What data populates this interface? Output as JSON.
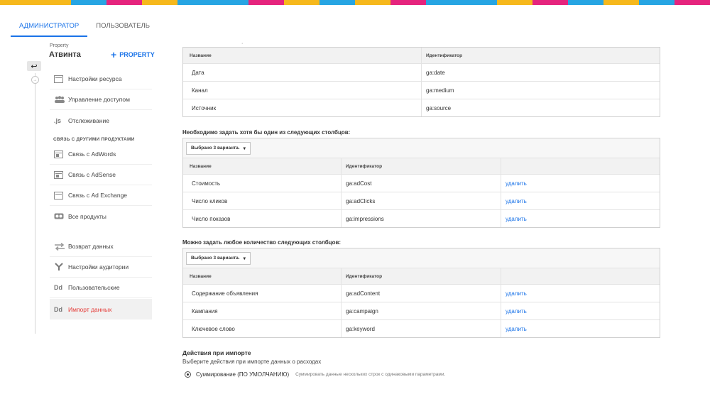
{
  "stripe_colors": [
    "#f6b81c",
    "#f6b81c",
    "#27a5e3",
    "#e5247d",
    "#f6b81c",
    "#27a5e3",
    "#27a5e3",
    "#e5247d",
    "#f6b81c",
    "#27a5e3",
    "#f6b81c",
    "#e5247d",
    "#27a5e3",
    "#27a5e3",
    "#f6b81c",
    "#e5247d",
    "#27a5e3",
    "#f6b81c",
    "#27a5e3",
    "#e5247d"
  ],
  "tabs": [
    {
      "label": "АДМИНИСТРАТОР",
      "active": true
    },
    {
      "label": "ПОЛЬЗОВАТЕЛЬ",
      "active": false
    }
  ],
  "property": {
    "label": "Property",
    "name": "Атвинта",
    "add_label": "PROPERTY",
    "add_icon": "plus-icon"
  },
  "nav": {
    "section_head": "СВЯЗЬ С ДРУГИМИ ПРОДУКТАМИ",
    "items": [
      {
        "label": "Настройки ресурса",
        "icon": "settings-page-icon"
      },
      {
        "label": "Управление доступом",
        "icon": "people-icon"
      },
      {
        "label": "Отслеживание",
        "icon": "js-icon",
        "glyph": ".js"
      },
      {
        "label": "Связь с AdWords",
        "icon": "adwords-icon"
      },
      {
        "label": "Связь с AdSense",
        "icon": "adsense-icon"
      },
      {
        "label": "Связь с Ad Exchange",
        "icon": "adexchange-icon"
      },
      {
        "label": "Все продукты",
        "icon": "products-icon"
      },
      {
        "label": "Возврат данных",
        "icon": "sync-arrows-icon"
      },
      {
        "label": "Настройки аудитории",
        "icon": "audience-fork-icon"
      },
      {
        "label": "Пользовательские",
        "icon": "dd-icon",
        "glyph": "Dd"
      },
      {
        "label": "Импорт данных",
        "icon": "dd-icon",
        "glyph": "Dd",
        "selected": true
      }
    ]
  },
  "top_marker": "·",
  "table1": {
    "headers": [
      "Название",
      "Идентификатор"
    ],
    "rows": [
      [
        "Дата",
        "ga:date"
      ],
      [
        "Канал",
        "ga:medium"
      ],
      [
        "Источник",
        "ga:source"
      ]
    ]
  },
  "section2": {
    "title": "Необходимо задать хотя бы один из следующих столбцов:",
    "dropdown": "Выбрано 3 варианта.",
    "headers": [
      "Название",
      "Идентификатор",
      ""
    ],
    "rows": [
      [
        "Стоимость",
        "ga:adCost",
        "удалить"
      ],
      [
        "Число кликов",
        "ga:adClicks",
        "удалить"
      ],
      [
        "Число показов",
        "ga:impressions",
        "удалить"
      ]
    ]
  },
  "section3": {
    "title": "Можно задать любое количество следующих столбцов:",
    "dropdown": "Выбрано 3 варианта.",
    "headers": [
      "Название",
      "Идентификатор",
      ""
    ],
    "rows": [
      [
        "Содержание объявления",
        "ga:adContent",
        "удалить"
      ],
      [
        "Кампания",
        "ga:campaign",
        "удалить"
      ],
      [
        "Ключевое слово",
        "ga:keyword",
        "удалить"
      ]
    ]
  },
  "import_actions": {
    "title": "Действия при импорте",
    "subtitle": "Выберите действия при импорте данных о расходах",
    "option_label": "Суммирование (ПО УМОЛЧАНИЮ)",
    "option_hint": "Суммировать данные нескольких строк с одинаковыми параметрами.",
    "option_selected": true
  },
  "colors": {
    "accent": "#1a73e8",
    "selected_nav": "#e53935"
  }
}
